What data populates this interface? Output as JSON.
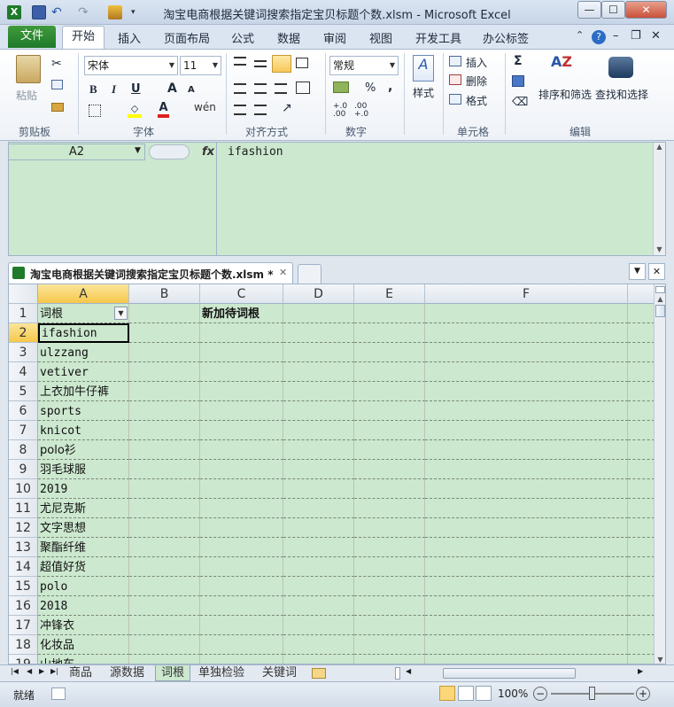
{
  "window": {
    "title": "淘宝电商根据关键词搜索指定宝贝标题个数.xlsm  -  Microsoft Excel",
    "minimize": "—",
    "maximize": "☐",
    "close": "✕"
  },
  "ribbon_tabs": {
    "file": "文件",
    "items": [
      "开始",
      "插入",
      "页面布局",
      "公式",
      "数据",
      "审阅",
      "视图",
      "开发工具",
      "办公标签"
    ],
    "active": "开始"
  },
  "ribbon": {
    "clipboard": {
      "paste": "粘贴",
      "label": "剪贴板"
    },
    "font": {
      "name": "宋体",
      "size": "11",
      "bold": "B",
      "italic": "I",
      "underline": "U",
      "grow": "A",
      "shrink": "A",
      "color": "A",
      "wen": "wén",
      "label": "字体"
    },
    "alignment": {
      "label": "对齐方式"
    },
    "number": {
      "format": "常规",
      "percent": "%",
      "comma": ",",
      "inc": "+.0 .00",
      "dec": ".00 +.0",
      "label": "数字"
    },
    "styles": {
      "label": "样式"
    },
    "cells": {
      "insert": "插入",
      "delete": "删除",
      "format": "格式",
      "label": "单元格"
    },
    "editing": {
      "sum": "Σ",
      "sort": "排序和筛选",
      "find": "查找和选择",
      "label": "编辑"
    }
  },
  "formula_bar": {
    "name_box": "A2",
    "fx": "fx",
    "formula": "ifashion"
  },
  "document_tab": {
    "title": "淘宝电商根据关键词搜索指定宝贝标题个数.xlsm *",
    "close": "✕"
  },
  "grid": {
    "columns": [
      "A",
      "B",
      "C",
      "D",
      "E",
      "F"
    ],
    "rows": [
      {
        "num": "1",
        "a": "词根",
        "c": "新加待词根"
      },
      {
        "num": "2",
        "a": "ifashion",
        "c": ""
      },
      {
        "num": "3",
        "a": "ulzzang",
        "c": ""
      },
      {
        "num": "4",
        "a": "vetiver",
        "c": ""
      },
      {
        "num": "5",
        "a": "上衣加牛仔裤",
        "c": ""
      },
      {
        "num": "6",
        "a": "sports",
        "c": ""
      },
      {
        "num": "7",
        "a": "knicot",
        "c": ""
      },
      {
        "num": "8",
        "a": "polo衫",
        "c": ""
      },
      {
        "num": "9",
        "a": "羽毛球服",
        "c": ""
      },
      {
        "num": "10",
        "a": "2019",
        "c": ""
      },
      {
        "num": "11",
        "a": "尤尼克斯",
        "c": ""
      },
      {
        "num": "12",
        "a": "文字思想",
        "c": ""
      },
      {
        "num": "13",
        "a": "聚酯纤维",
        "c": ""
      },
      {
        "num": "14",
        "a": "超值好货",
        "c": ""
      },
      {
        "num": "15",
        "a": "polo",
        "c": ""
      },
      {
        "num": "16",
        "a": "2018",
        "c": ""
      },
      {
        "num": "17",
        "a": "冲锋衣",
        "c": ""
      },
      {
        "num": "18",
        "a": "化妆品",
        "c": ""
      },
      {
        "num": "19",
        "a": "山地车",
        "c": ""
      }
    ],
    "selected_cell": "A2"
  },
  "sheet_tabs": [
    "商品",
    "源数据",
    "词根",
    "单独检验",
    "关键词"
  ],
  "active_sheet": "词根",
  "status": {
    "ready": "就绪",
    "zoom": "100%"
  },
  "colors": {
    "cell_bg": "#cce8cf",
    "file_tab": "#2a8a33",
    "header_selected": "#f5c84a"
  }
}
